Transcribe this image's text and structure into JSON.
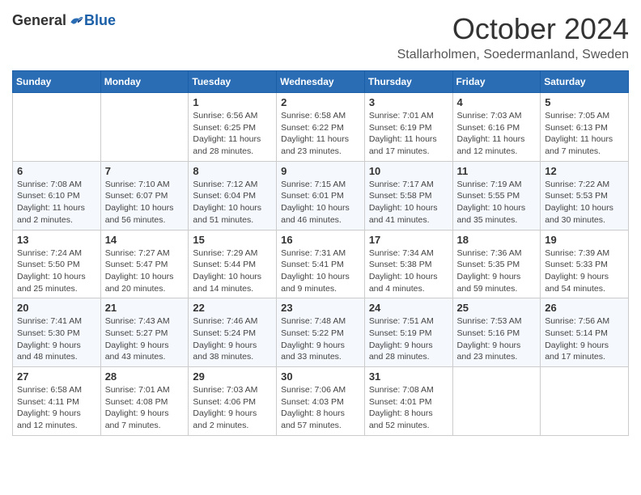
{
  "logo": {
    "general": "General",
    "blue": "Blue"
  },
  "title": "October 2024",
  "location": "Stallarholmen, Soedermanland, Sweden",
  "days_of_week": [
    "Sunday",
    "Monday",
    "Tuesday",
    "Wednesday",
    "Thursday",
    "Friday",
    "Saturday"
  ],
  "weeks": [
    [
      {
        "day": "",
        "info": ""
      },
      {
        "day": "",
        "info": ""
      },
      {
        "day": "1",
        "info": "Sunrise: 6:56 AM\nSunset: 6:25 PM\nDaylight: 11 hours and 28 minutes."
      },
      {
        "day": "2",
        "info": "Sunrise: 6:58 AM\nSunset: 6:22 PM\nDaylight: 11 hours and 23 minutes."
      },
      {
        "day": "3",
        "info": "Sunrise: 7:01 AM\nSunset: 6:19 PM\nDaylight: 11 hours and 17 minutes."
      },
      {
        "day": "4",
        "info": "Sunrise: 7:03 AM\nSunset: 6:16 PM\nDaylight: 11 hours and 12 minutes."
      },
      {
        "day": "5",
        "info": "Sunrise: 7:05 AM\nSunset: 6:13 PM\nDaylight: 11 hours and 7 minutes."
      }
    ],
    [
      {
        "day": "6",
        "info": "Sunrise: 7:08 AM\nSunset: 6:10 PM\nDaylight: 11 hours and 2 minutes."
      },
      {
        "day": "7",
        "info": "Sunrise: 7:10 AM\nSunset: 6:07 PM\nDaylight: 10 hours and 56 minutes."
      },
      {
        "day": "8",
        "info": "Sunrise: 7:12 AM\nSunset: 6:04 PM\nDaylight: 10 hours and 51 minutes."
      },
      {
        "day": "9",
        "info": "Sunrise: 7:15 AM\nSunset: 6:01 PM\nDaylight: 10 hours and 46 minutes."
      },
      {
        "day": "10",
        "info": "Sunrise: 7:17 AM\nSunset: 5:58 PM\nDaylight: 10 hours and 41 minutes."
      },
      {
        "day": "11",
        "info": "Sunrise: 7:19 AM\nSunset: 5:55 PM\nDaylight: 10 hours and 35 minutes."
      },
      {
        "day": "12",
        "info": "Sunrise: 7:22 AM\nSunset: 5:53 PM\nDaylight: 10 hours and 30 minutes."
      }
    ],
    [
      {
        "day": "13",
        "info": "Sunrise: 7:24 AM\nSunset: 5:50 PM\nDaylight: 10 hours and 25 minutes."
      },
      {
        "day": "14",
        "info": "Sunrise: 7:27 AM\nSunset: 5:47 PM\nDaylight: 10 hours and 20 minutes."
      },
      {
        "day": "15",
        "info": "Sunrise: 7:29 AM\nSunset: 5:44 PM\nDaylight: 10 hours and 14 minutes."
      },
      {
        "day": "16",
        "info": "Sunrise: 7:31 AM\nSunset: 5:41 PM\nDaylight: 10 hours and 9 minutes."
      },
      {
        "day": "17",
        "info": "Sunrise: 7:34 AM\nSunset: 5:38 PM\nDaylight: 10 hours and 4 minutes."
      },
      {
        "day": "18",
        "info": "Sunrise: 7:36 AM\nSunset: 5:35 PM\nDaylight: 9 hours and 59 minutes."
      },
      {
        "day": "19",
        "info": "Sunrise: 7:39 AM\nSunset: 5:33 PM\nDaylight: 9 hours and 54 minutes."
      }
    ],
    [
      {
        "day": "20",
        "info": "Sunrise: 7:41 AM\nSunset: 5:30 PM\nDaylight: 9 hours and 48 minutes."
      },
      {
        "day": "21",
        "info": "Sunrise: 7:43 AM\nSunset: 5:27 PM\nDaylight: 9 hours and 43 minutes."
      },
      {
        "day": "22",
        "info": "Sunrise: 7:46 AM\nSunset: 5:24 PM\nDaylight: 9 hours and 38 minutes."
      },
      {
        "day": "23",
        "info": "Sunrise: 7:48 AM\nSunset: 5:22 PM\nDaylight: 9 hours and 33 minutes."
      },
      {
        "day": "24",
        "info": "Sunrise: 7:51 AM\nSunset: 5:19 PM\nDaylight: 9 hours and 28 minutes."
      },
      {
        "day": "25",
        "info": "Sunrise: 7:53 AM\nSunset: 5:16 PM\nDaylight: 9 hours and 23 minutes."
      },
      {
        "day": "26",
        "info": "Sunrise: 7:56 AM\nSunset: 5:14 PM\nDaylight: 9 hours and 17 minutes."
      }
    ],
    [
      {
        "day": "27",
        "info": "Sunrise: 6:58 AM\nSunset: 4:11 PM\nDaylight: 9 hours and 12 minutes."
      },
      {
        "day": "28",
        "info": "Sunrise: 7:01 AM\nSunset: 4:08 PM\nDaylight: 9 hours and 7 minutes."
      },
      {
        "day": "29",
        "info": "Sunrise: 7:03 AM\nSunset: 4:06 PM\nDaylight: 9 hours and 2 minutes."
      },
      {
        "day": "30",
        "info": "Sunrise: 7:06 AM\nSunset: 4:03 PM\nDaylight: 8 hours and 57 minutes."
      },
      {
        "day": "31",
        "info": "Sunrise: 7:08 AM\nSunset: 4:01 PM\nDaylight: 8 hours and 52 minutes."
      },
      {
        "day": "",
        "info": ""
      },
      {
        "day": "",
        "info": ""
      }
    ]
  ]
}
